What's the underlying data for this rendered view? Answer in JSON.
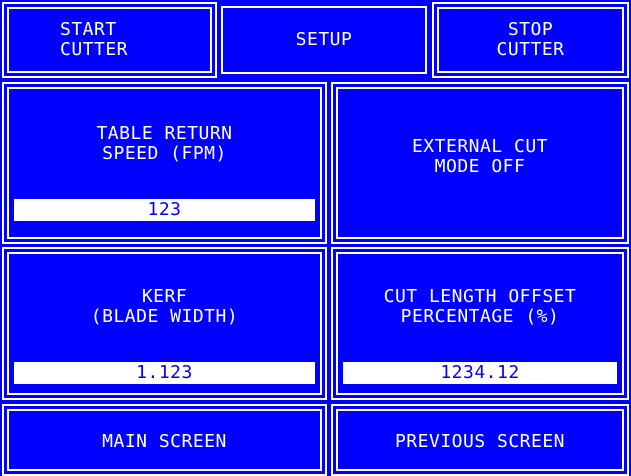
{
  "top_bar": {
    "start_cutter": [
      "START",
      "CUTTER"
    ],
    "setup": "SETUP",
    "stop_cutter": [
      "STOP",
      "CUTTER"
    ]
  },
  "table_return": {
    "label": [
      "TABLE RETURN",
      "SPEED (FPM)"
    ],
    "value": "123"
  },
  "external_cut": {
    "label": [
      "EXTERNAL CUT",
      "MODE OFF"
    ]
  },
  "kerf": {
    "label": [
      "KERF",
      "(BLADE WIDTH)"
    ],
    "value": "1.123"
  },
  "cut_length_offset": {
    "label": [
      "CUT LENGTH OFFSET",
      "PERCENTAGE (%)"
    ],
    "value": "1234.12"
  },
  "bottom_bar": {
    "main_screen": "MAIN SCREEN",
    "previous_screen": "PREVIOUS SCREEN"
  },
  "colors": {
    "background": "#0000ff",
    "foreground": "#ffffff"
  }
}
